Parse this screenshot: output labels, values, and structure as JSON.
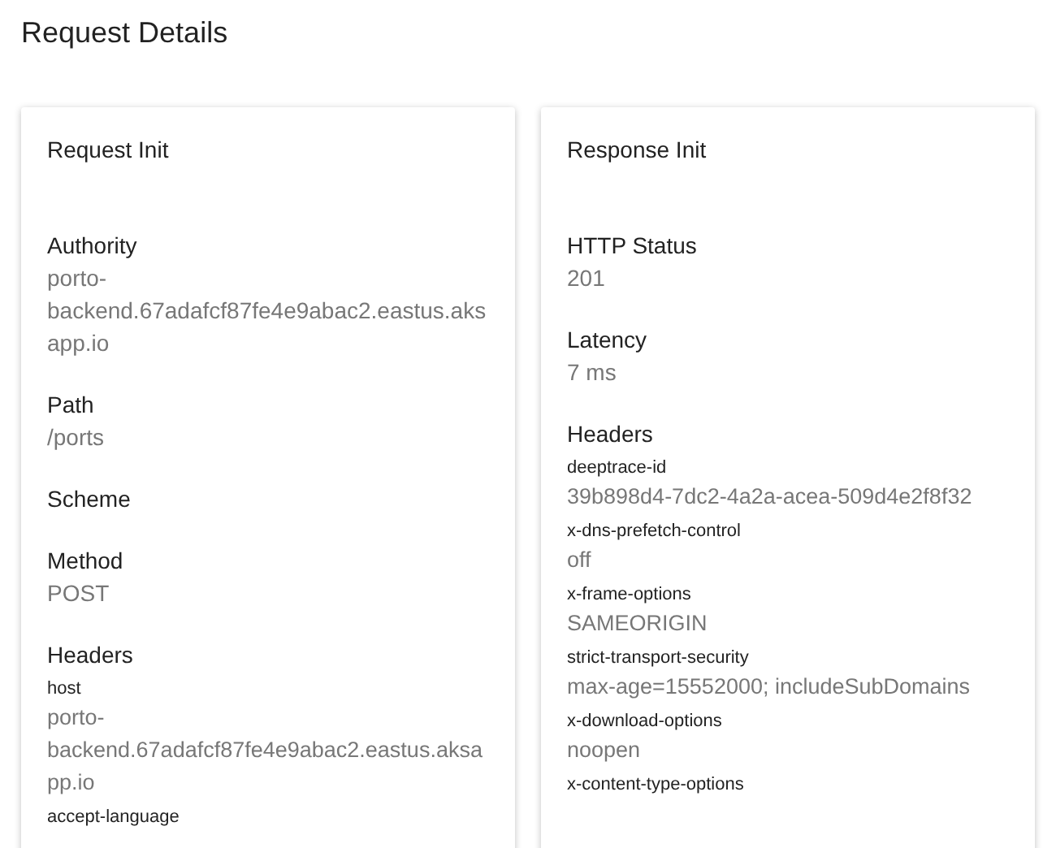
{
  "title": "Request Details",
  "cards": [
    {
      "title": "Request Init",
      "fields": [
        {
          "kind": "field",
          "label": "Authority",
          "value": "porto-backend.67adafcf87fe4e9abac2.eastus.aksapp.io"
        },
        {
          "kind": "field",
          "label": "Path",
          "value": "/ports"
        },
        {
          "kind": "field",
          "label": "Scheme"
        },
        {
          "kind": "field",
          "label": "Method",
          "value": "POST"
        },
        {
          "kind": "headers",
          "label": "Headers",
          "headers": [
            {
              "name": "host",
              "value": "porto-backend.67adafcf87fe4e9abac2.eastus.aksapp.io"
            },
            {
              "name": "accept-language"
            }
          ]
        }
      ]
    },
    {
      "title": "Response Init",
      "fields": [
        {
          "kind": "field",
          "label": "HTTP Status",
          "value": "201"
        },
        {
          "kind": "field",
          "label": "Latency",
          "value": "7 ms"
        },
        {
          "kind": "headers",
          "label": "Headers",
          "headers": [
            {
              "name": "deeptrace-id",
              "value": "39b898d4-7dc2-4a2a-acea-509d4e2f8f32"
            },
            {
              "name": "x-dns-prefetch-control",
              "value": "off"
            },
            {
              "name": "x-frame-options",
              "value": "SAMEORIGIN"
            },
            {
              "name": "strict-transport-security",
              "value": "max-age=15552000; includeSubDomains"
            },
            {
              "name": "x-download-options",
              "value": "noopen"
            },
            {
              "name": "x-content-type-options"
            }
          ]
        }
      ]
    }
  ]
}
